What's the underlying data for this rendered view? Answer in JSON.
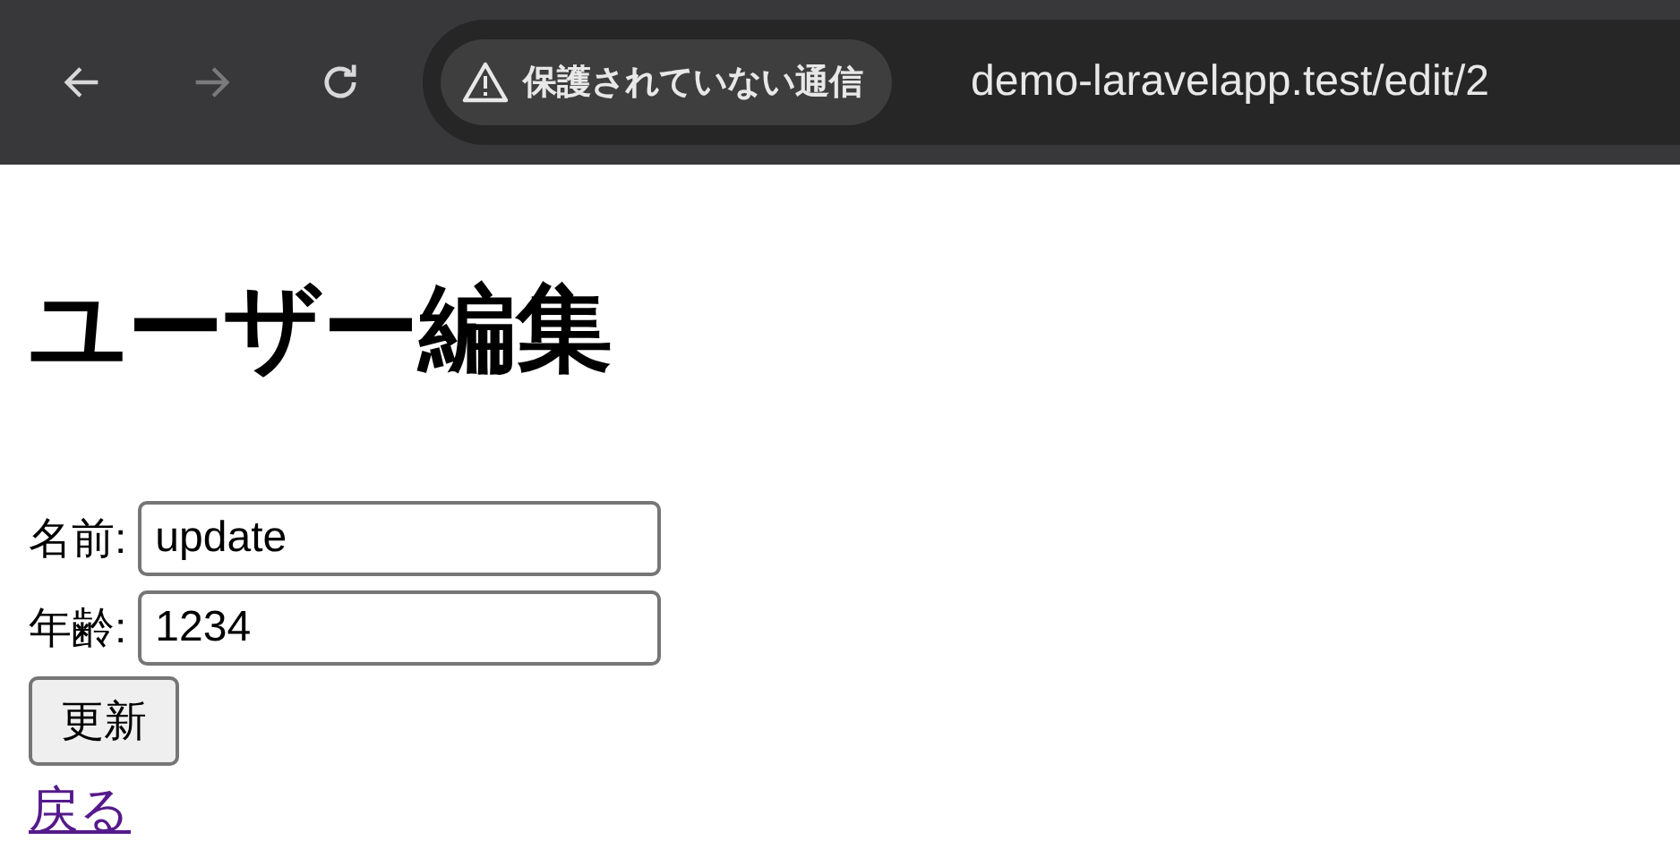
{
  "toolbar": {
    "nav_buttons": [
      {
        "kind": "back",
        "disabled": false
      },
      {
        "kind": "forward",
        "disabled": true
      },
      {
        "kind": "reload",
        "disabled": false
      }
    ],
    "security_chip": {
      "label": "保護されていない通信"
    },
    "url": "demo-laravelapp.test/edit/2"
  },
  "page": {
    "heading": "ユーザー編集",
    "fields": [
      {
        "label": "名前:",
        "value": "update"
      },
      {
        "label": "年齢:",
        "value": "1234"
      }
    ],
    "submit_button": "更新",
    "back_link": "戻る"
  }
}
